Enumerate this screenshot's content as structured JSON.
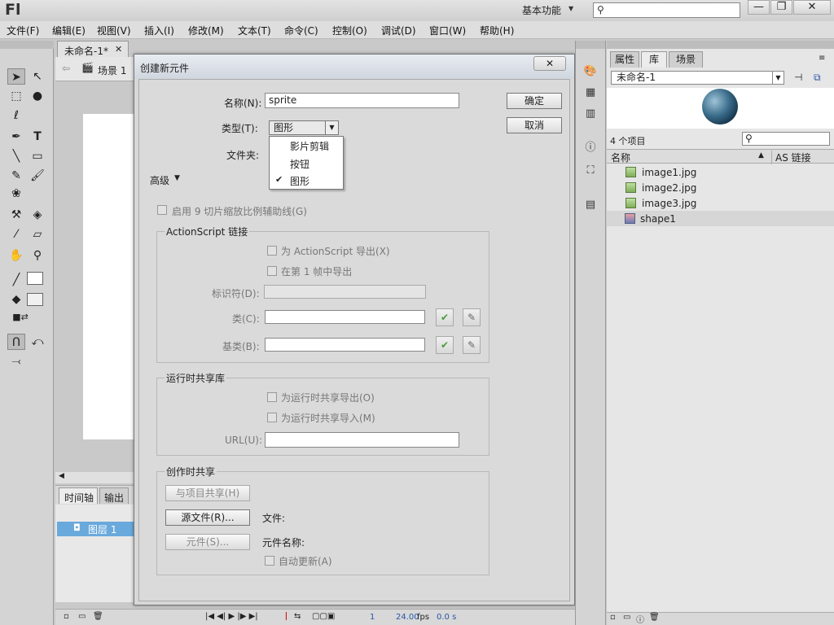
{
  "app": {
    "logo": "Fl",
    "workspace": "基本功能"
  },
  "menu": [
    "文件(F)",
    "编辑(E)",
    "视图(V)",
    "插入(I)",
    "修改(M)",
    "文本(T)",
    "命令(C)",
    "控制(O)",
    "调试(D)",
    "窗口(W)",
    "帮助(H)"
  ],
  "document": {
    "tab": "未命名-1*",
    "scene": "场景 1"
  },
  "timeline": {
    "tab1": "时间轴",
    "tab2": "输出",
    "layer": "图层 1"
  },
  "playback": {
    "frame": "1",
    "fps": "24.00",
    "fps_unit": "fps",
    "time": "0.0 s"
  },
  "dialog": {
    "title": "创建新元件",
    "name_label": "名称(N):",
    "name_value": "sprite",
    "type_label": "类型(T):",
    "type_value": "图形",
    "type_options": [
      "影片剪辑",
      "按钮",
      "图形"
    ],
    "folder_label": "文件夹:",
    "ok": "确定",
    "cancel": "取消",
    "advanced": "高级",
    "scale9": "启用 9 切片缩放比例辅助线(G)",
    "as_group": "ActionScript 链接",
    "export_as": "为 ActionScript 导出(X)",
    "export_frame1": "在第 1 帧中导出",
    "identifier": "标识符(D):",
    "class": "类(C):",
    "base_class": "基类(B):",
    "rsl_group": "运行时共享库",
    "rsl_export": "为运行时共享导出(O)",
    "rsl_import": "为运行时共享导入(M)",
    "url": "URL(U):",
    "authoring_group": "创作时共享",
    "share_project": "与项目共享(H)",
    "source_file": "源文件(R)...",
    "file_label": "文件:",
    "symbol_btn": "元件(S)...",
    "symbol_name": "元件名称:",
    "auto_update": "自动更新(A)"
  },
  "library": {
    "tabs": [
      "属性",
      "库",
      "场景"
    ],
    "document": "未命名-1",
    "count": "4 个项目",
    "col_name": "名称",
    "col_link": "AS 链接",
    "items": [
      {
        "name": "image1.jpg",
        "kind": "bitmap"
      },
      {
        "name": "image2.jpg",
        "kind": "bitmap"
      },
      {
        "name": "image3.jpg",
        "kind": "bitmap"
      },
      {
        "name": "shape1",
        "kind": "graphic"
      }
    ]
  }
}
